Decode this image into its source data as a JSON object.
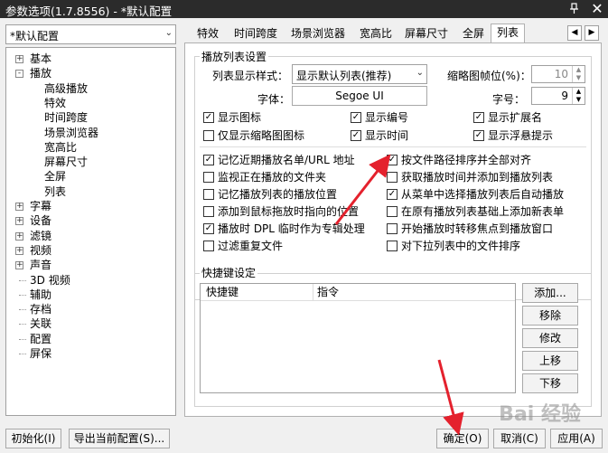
{
  "window": {
    "title": "参数选项(1.7.8556) - *默认配置",
    "pin_icon": "pin-icon",
    "close_icon": "close-icon"
  },
  "profile_combo": {
    "value": "*默认配置"
  },
  "tree": {
    "items": [
      {
        "label": "基本",
        "level": 0,
        "expand": "+"
      },
      {
        "label": "播放",
        "level": 0,
        "expand": "-"
      },
      {
        "label": "高级播放",
        "level": 1
      },
      {
        "label": "特效",
        "level": 1
      },
      {
        "label": "时间跨度",
        "level": 1
      },
      {
        "label": "场景浏览器",
        "level": 1
      },
      {
        "label": "宽高比",
        "level": 1
      },
      {
        "label": "屏幕尺寸",
        "level": 1
      },
      {
        "label": "全屏",
        "level": 1
      },
      {
        "label": "列表",
        "level": 1
      },
      {
        "label": "字幕",
        "level": 0,
        "expand": "+"
      },
      {
        "label": "设备",
        "level": 0,
        "expand": "+"
      },
      {
        "label": "滤镜",
        "level": 0,
        "expand": "+"
      },
      {
        "label": "视频",
        "level": 0,
        "expand": "+"
      },
      {
        "label": "声音",
        "level": 0,
        "expand": "+"
      },
      {
        "label": "3D 视频",
        "level": 0
      },
      {
        "label": "辅助",
        "level": 0
      },
      {
        "label": "存档",
        "level": 0
      },
      {
        "label": "关联",
        "level": 0
      },
      {
        "label": "配置",
        "level": 0
      },
      {
        "label": "屏保",
        "level": 0
      }
    ]
  },
  "tabs": [
    "特效",
    "时间跨度",
    "场景浏览器",
    "宽高比",
    "屏幕尺寸",
    "全屏",
    "列表"
  ],
  "active_tab": "列表",
  "playlist_settings": {
    "group_label": "播放列表设置",
    "style_label": "列表显示样式：",
    "style_value": "显示默认列表(推荐)",
    "thumb_fps_label": "缩略图帧位(%)：",
    "thumb_fps_value": "10",
    "font_label": "字体：",
    "font_value": "Segoe UI",
    "size_label": "字号：",
    "size_value": "9",
    "checks_top": [
      {
        "label": "显示图标",
        "checked": true
      },
      {
        "label": "显示编号",
        "checked": true
      },
      {
        "label": "显示扩展名",
        "checked": true
      },
      {
        "label": "仅显示缩略图图标",
        "checked": false
      },
      {
        "label": "显示时间",
        "checked": true
      },
      {
        "label": "显示浮悬提示",
        "checked": true
      }
    ],
    "checks_left": [
      {
        "label": "记忆近期播放名单/URL 地址",
        "checked": true
      },
      {
        "label": "监视正在播放的文件夹",
        "checked": false
      },
      {
        "label": "记忆播放列表的播放位置",
        "checked": false
      },
      {
        "label": "添加到鼠标拖放时指向的位置",
        "checked": false
      },
      {
        "label": "播放时 DPL 临时作为专辑处理",
        "checked": true
      },
      {
        "label": "过滤重复文件",
        "checked": false
      }
    ],
    "checks_right": [
      {
        "label": "按文件路径排序并全部对齐",
        "checked": true
      },
      {
        "label": "获取播放时间并添加到播放列表",
        "checked": false
      },
      {
        "label": "从菜单中选择播放列表后自动播放",
        "checked": true
      },
      {
        "label": "在原有播放列表基础上添加新表单",
        "checked": false
      },
      {
        "label": "开始播放时转移焦点到播放窗口",
        "checked": false
      },
      {
        "label": "对下拉列表中的文件排序",
        "checked": false
      }
    ]
  },
  "shortcuts": {
    "group_label": "快捷键设定",
    "col_key": "快捷键",
    "col_cmd": "指令",
    "buttons": [
      "添加...",
      "移除",
      "修改",
      "上移",
      "下移"
    ]
  },
  "footer": {
    "init_btn": "初始化(I)",
    "export_btn": "导出当前配置(S)...",
    "ok_btn": "确定(O)",
    "cancel_btn": "取消(C)",
    "apply_btn": "应用(A)"
  },
  "watermark": "Bai 经验",
  "colors": {
    "annotation_arrow": "#e4212d",
    "title_bg": "#2b2b2b"
  }
}
